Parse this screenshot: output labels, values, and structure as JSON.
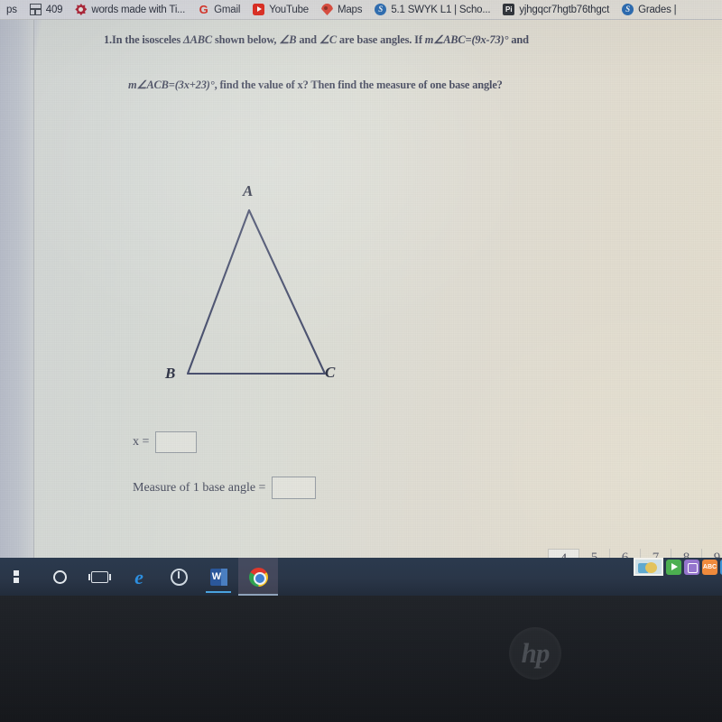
{
  "browser": {
    "bookmarks": [
      {
        "label": "ps",
        "icon": "apps-grid-icon"
      },
      {
        "label": "409",
        "icon": "grid-icon"
      },
      {
        "label": "words made with Ti...",
        "icon": "flower-icon"
      },
      {
        "label": "Gmail",
        "icon": "gmail-icon"
      },
      {
        "label": "YouTube",
        "icon": "youtube-icon"
      },
      {
        "label": "Maps",
        "icon": "map-pin-icon"
      },
      {
        "label": "5.1 SWYK L1 | Scho...",
        "icon": "schoology-icon"
      },
      {
        "label": "yjhgqcr7hgtb76thgct",
        "icon": "pi-icon"
      },
      {
        "label": "Grades |",
        "icon": "schoology-icon"
      }
    ]
  },
  "worksheet": {
    "question_number": "1.",
    "line1_part1": "In the isosceles ",
    "line1_triangle": "ΔABC",
    "line1_part2": " shown below, ",
    "line1_angle_b": "∠B",
    "line1_part3": " and ",
    "line1_angle_c": "∠C",
    "line1_part4": " are base angles. If ",
    "line1_expr": "m∠ABC=(9x-73)°",
    "line1_part5": " and",
    "line2_expr": "m∠ACB=(3x+23)°",
    "line2_rest": ", find the value of x?  Then find the measure of one base angle?",
    "figure": {
      "vertex_a": "A",
      "vertex_b": "B",
      "vertex_c": "C",
      "stroke_color": "#4b5270"
    },
    "answers": [
      {
        "label": "x =",
        "value": "",
        "name": "x-answer"
      },
      {
        "label": "Measure of 1 base angle =",
        "value": "",
        "name": "base-angle-answer"
      }
    ],
    "pagination": {
      "pages": [
        "4",
        "5",
        "6",
        "7",
        "8",
        "9"
      ],
      "selected": "4"
    },
    "app_dock": [
      {
        "icon": "image-thumbnail"
      },
      {
        "icon": "play-icon"
      },
      {
        "icon": "zoom-icon"
      },
      {
        "icon": "abc-icon",
        "label": "ABC"
      },
      {
        "icon": "picture-icon"
      }
    ]
  },
  "taskbar": {
    "items": [
      {
        "name": "start-button",
        "icon": "windows-logo-icon"
      },
      {
        "name": "cortana-button",
        "icon": "cortana-circle-icon"
      },
      {
        "name": "task-view-button",
        "icon": "task-view-icon"
      },
      {
        "name": "edge-button",
        "icon": "edge-icon",
        "glyph": "e"
      },
      {
        "name": "power-button",
        "icon": "power-icon"
      },
      {
        "name": "word-button",
        "icon": "word-icon",
        "glyph": "W"
      },
      {
        "name": "chrome-button",
        "icon": "chrome-icon"
      }
    ]
  },
  "hardware": {
    "brand": "hp"
  },
  "colors": {
    "page_bg": "#dcded7",
    "taskbar_bg": "#2a3648",
    "ink": "#4b4f63",
    "figure_stroke": "#4b5270",
    "bezel": "#1d2025"
  }
}
